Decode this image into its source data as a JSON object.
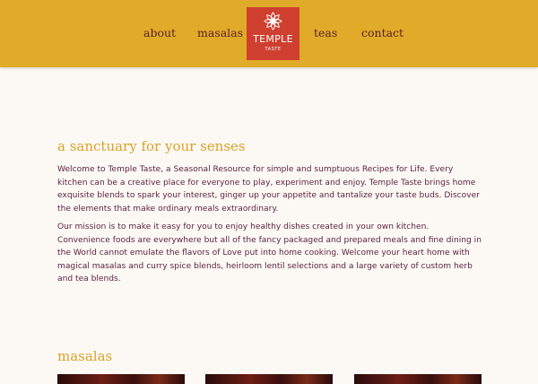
{
  "nav": {
    "about": "about",
    "masalas": "masalas",
    "teas": "teas",
    "contact": "contact"
  },
  "logo": {
    "title": "TEMPLE",
    "subtitle": "TASTE",
    "icon": "mandala-icon"
  },
  "intro": {
    "heading": "a sanctuary for your senses",
    "paragraph1": "Welcome to Temple Taste, a Seasonal Resource for simple and sumptuous Recipes for Life. Every kitchen can be a creative place for everyone to play, experiment and enjoy. Temple Taste brings home exquisite blends to spark your interest, ginger up your appetite and tantalize your taste buds. Discover the elements that make ordinary meals extraordinary.",
    "paragraph2": "Our mission is to make it easy for you to enjoy healthy dishes created in your own kitchen. Convenience foods are everywhere but all of the fancy packaged and prepared meals and fine dining in the World cannot emulate the flavors of Love put into home cooking. Welcome your heart home with magical masalas and curry spice blends, heirloom lentil selections and a large variety of custom herb and tea blends."
  },
  "masalas": {
    "heading": "masalas"
  },
  "colors": {
    "header": "#e0ab28",
    "logo": "#cf3f2f",
    "heading": "#d9a22a",
    "text": "#5a1f3c",
    "background": "#fcf9f4"
  }
}
